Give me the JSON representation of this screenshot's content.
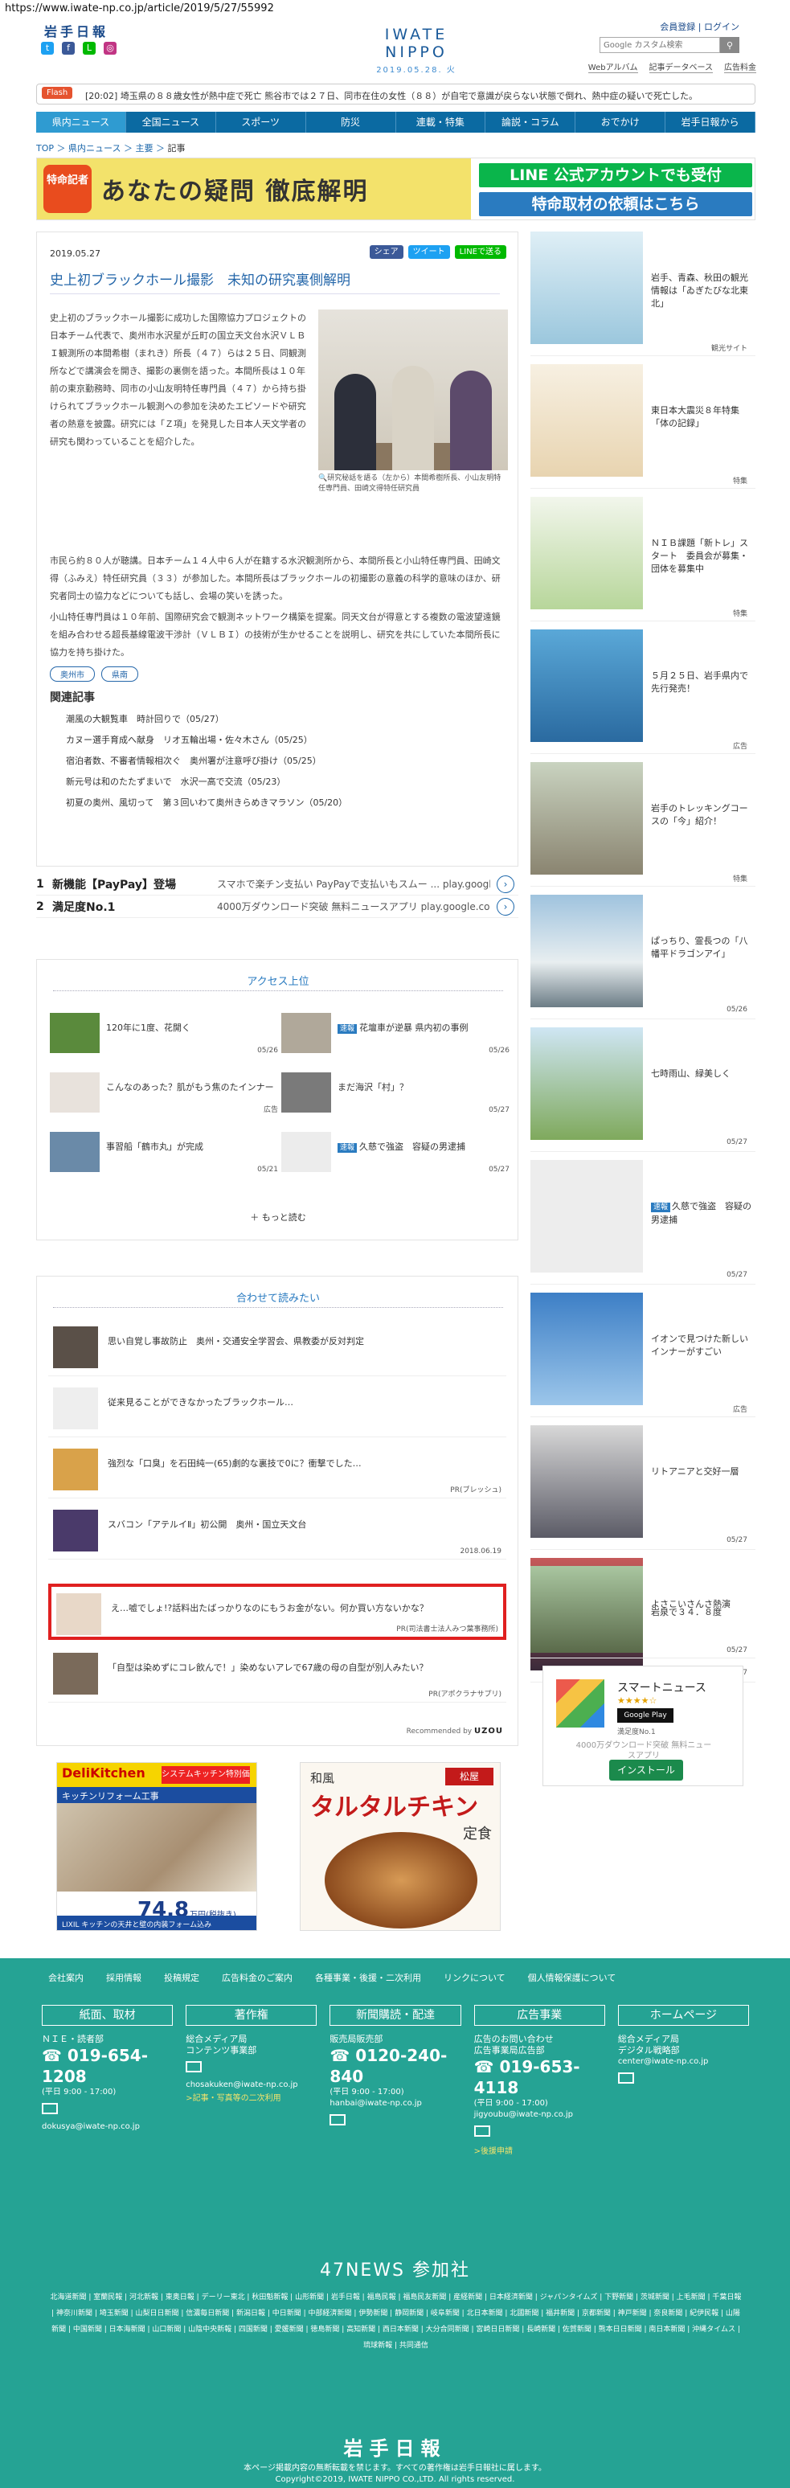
{
  "url": "https://www.iwate-np.co.jp/article/2019/5/27/55992",
  "header": {
    "logo_small": "岩手日報",
    "brand": "IWATE NIPPO",
    "brand_date": "2019.05.28. 火",
    "member_register": "会員登録",
    "login": "ログイン",
    "search_placeholder": "Google カスタム検索",
    "subnav": [
      "Webアルバム",
      "記事データベース",
      "広告料金"
    ]
  },
  "flash": {
    "tag": "Flash",
    "text": "[20:02] 埼玉県の８８歳女性が熱中症で死亡   熊谷市では２７日、同市在住の女性（８８）が自宅で意識が戻らない状態で倒れ、熱中症の疑いで死亡した。"
  },
  "gnav": [
    "県内ニュース",
    "全国ニュース",
    "スポーツ",
    "防災",
    "連載・特集",
    "論説・コラム",
    "おでかけ",
    "岩手日報から"
  ],
  "breadcrumb": [
    "TOP",
    "県内ニュース",
    "主要",
    "記事"
  ],
  "banner": {
    "badge": "特命記者",
    "title": "あなたの疑問 徹底解明",
    "line1": "LINE 公式アカウントでも受付",
    "line2": "特命取材の依頼はこちら"
  },
  "article": {
    "date": "2019.05.27",
    "share": [
      "シェア",
      "ツイート",
      "LINEで送る"
    ],
    "title": "史上初ブラックホール撮影　未知の研究裏側解明",
    "body_p1": "史上初のブラックホール撮影に成功した国際協力プロジェクトの日本チーム代表で、奥州市水沢星が丘町の国立天文台水沢ＶＬＢＩ観測所の本間希樹（まれき）所長（４７）らは２５日、同観測所などで講演会を開き、撮影の裏側を語った。本間所長は１０年前の東京勤務時、同市の小山友明特任専門員（４７）から持ち掛けられてブラックホール観測への参加を決めたエピソードや研究者の熱意を披露。研究には「Ｚ項」を発見した日本人天文学者の研究も関わっていることを紹介した。",
    "body_p2": "市民ら約８０人が聴講。日本チーム１４人中６人が在籍する水沢観測所から、本間所長と小山特任専門員、田崎文得（ふみえ）特任研究員（３３）が参加した。本間所長はブラックホールの初撮影の意義の科学的意味のほか、研究者同士の協力などについても話し、会場の笑いを誘った。",
    "body_p3": "小山特任専門員は１０年前、国際研究会で観測ネットワーク構築を提案。同天文台が得意とする複数の電波望遠鏡を組み合わせる超長基線電波干渉計（ＶＬＢＩ）の技術が生かせることを説明し、研究を共にしていた本間所長に協力を持ち掛けた。",
    "caption": "研究秘話を語る（左から）本間希樹所長、小山友明特任専門員、田崎文得特任研究員",
    "tags": [
      "奥州市",
      "県南"
    ],
    "related_heading": "関連記事",
    "related": [
      "潮風の大観覧車　時計回りで（05/27）",
      "カヌー選手育成へ献身　リオ五輪出場・佐々木さん（05/25）",
      "宿泊者数、不審者情報相次ぐ　奥州署が注意呼び掛け（05/25）",
      "新元号は和のたたずまいで　水沢一高で交流（05/23）",
      "初夏の奥州、風切って　第３回いわて奥州きらめきマラソン（05/20）"
    ]
  },
  "ads_inline": [
    {
      "num": "1",
      "title": "新機能【PayPay】登場",
      "desc": "スマホで楽チン支払い PayPayで支払いもスムー ... play.google.com"
    },
    {
      "num": "2",
      "title": "満足度No.1",
      "desc": "4000万ダウンロード突破 無料ニュースアプリ play.google.com"
    }
  ],
  "ranking": {
    "heading": "アクセス上位",
    "items": [
      {
        "badge": "",
        "text": "120年に1度、花開く",
        "date": "05/26"
      },
      {
        "badge": "速報",
        "text": "花壇車が逆暴 県内初の事例",
        "date": "05/26"
      },
      {
        "badge": "",
        "text": "こんなのあった？肌がもう焦のたインナー",
        "date": "広告"
      },
      {
        "badge": "",
        "text": "まだ海沢「村」？",
        "date": "05/27"
      },
      {
        "badge": "",
        "text": "事習船「鶴市丸」が完成",
        "date": "05/21"
      },
      {
        "badge": "速報",
        "text": "久慈で強盗　容疑の男逮捕",
        "date": "05/27"
      }
    ],
    "more": "もっと読む"
  },
  "recommended": {
    "heading": "合わせて読みたい",
    "items": [
      {
        "text": "思い自覚し事故防止　奥州・交通安全学習会、県教委が反対判定",
        "date": ""
      },
      {
        "text": "従来見ることができなかったブラックホール…",
        "date": ""
      },
      {
        "text": "強烈な「口臭」を石田純一(65)劇的な裏技で0に？衝撃でした…",
        "date": "PR(ブレッシュ)"
      },
      {
        "text": "スバコン「アテルイⅡ」初公開　奥州・国立天文台",
        "date": "2018.06.19"
      },
      {
        "text": "え…嘘でしょ!?話料出たばっかりなのにもうお金がない。何か買い方ないかな？",
        "date": "PR(司法書士法人みつ葉事務所)"
      },
      {
        "text": "「自型は染めずにコレ飲んで！」染めないアレで67歳の母の自型が別人みたい？",
        "date": "PR(アポクラナサプリ)"
      }
    ],
    "recommended_by": "Recommended by",
    "uzou": "UZOU"
  },
  "bottom_ads": {
    "ad1": {
      "brand": "DeliKitchen",
      "sub": "システムキッチン特別価格",
      "bar": "キッチンリフォーム工事",
      "price": "74.8",
      "unit": "万円(税抜き)",
      "footer": "LIXIL キッチンの天井と壁の内装フォーム込み"
    },
    "ad2": {
      "t1": "和風",
      "t2": "タルタルチキン",
      "logo": "松屋",
      "sub": "定食"
    }
  },
  "sidebar": [
    {
      "badge": "",
      "text": "岩手、青森、秋田の観光情報は「ゐぎたびな北東北」",
      "foot": "観光サイト"
    },
    {
      "badge": "",
      "text": "東日本大震災８年特集「体の記録」",
      "foot": "特集"
    },
    {
      "badge": "",
      "text": "ＮＩＢ課題「新トレ」スタート　委員会が募集・団体を募集中",
      "foot": "特集"
    },
    {
      "badge": "",
      "text": "５月２５日、岩手県内で先行発売！",
      "foot": "広告"
    },
    {
      "badge": "",
      "text": "岩手のトレッキングコースの「今」紹介！",
      "foot": "特集"
    },
    {
      "badge": "",
      "text": "ぱっちり、霊長つの「八幡平ドラゴンアイ」",
      "foot": "05/26"
    },
    {
      "badge": "",
      "text": "七時雨山、緑美しく",
      "foot": "05/27"
    },
    {
      "badge": "速報",
      "text": "久慈で強盗　容疑の男逮捕",
      "foot": "05/27"
    },
    {
      "badge": "",
      "text": "イオンで見つけた新しいインナーがすごい",
      "foot": "広告"
    },
    {
      "badge": "",
      "text": "リトアニアと交好一層",
      "foot": "05/27"
    },
    {
      "badge": "",
      "text": "よさこいさんさ熱演",
      "foot": "05/27"
    },
    {
      "badge": "",
      "text": "岩泉で３４．８度",
      "foot": "05/27"
    }
  ],
  "smart_news": {
    "name": "スマートニュース",
    "stars": "★★★★☆",
    "store": "Google Play",
    "sub": "満足度No.1",
    "desc": "4000万ダウンロード突破 無料ニュースアプリ",
    "button": "インストール"
  },
  "footer": {
    "links": [
      "会社案内",
      "採用情報",
      "投稿規定",
      "広告料金のご案内",
      "各種事業・後援・二次利用",
      "リンクについて",
      "個人情報保護について"
    ],
    "cols": [
      {
        "head": "紙面、取材",
        "label": "ＮＩＥ・読者部",
        "phone": "019-654-1208",
        "hours": "(平日 9:00 - 17:00)",
        "mail": "dokusya@iwate-np.co.jp",
        "extra": ""
      },
      {
        "head": "著作権",
        "label": "総合メディア局\nコンテンツ事業部",
        "phone": "",
        "hours": "",
        "mail": "chosakuken@iwate-np.co.jp",
        "extra": ">記事・写真等の二次利用"
      },
      {
        "head": "新聞購読・配達",
        "label": "販売局販売部",
        "phone": "0120-240-840",
        "hours": "(平日 9:00 - 17:00)",
        "mail": "hanbai@iwate-np.co.jp",
        "extra": ""
      },
      {
        "head": "広告事業",
        "label": "広告のお問い合わせ\n広告事業局広告部",
        "phone": "019-653-4118",
        "hours": "(平日 9:00 - 17:00)",
        "mail": "jigyoubu@iwate-np.co.jp",
        "extra": ">後援申請"
      },
      {
        "head": "ホームページ",
        "label": "総合メディア局\nデジタル戦略部",
        "phone": "",
        "hours": "",
        "mail": "center@iwate-np.co.jp",
        "extra": ""
      }
    ],
    "news47": "47NEWS 参加社",
    "papers": "北海道新聞 | 室蘭民報 | 河北新報 | 東奥日報 | デーリー東北 | 秋田魁新報 | 山形新聞 | 岩手日報 | 福島民報 | 福島民友新聞 | 産経新聞 | 日本経済新聞 | ジャパンタイムズ | 下野新聞 | 茨城新聞 | 上毛新聞 | 千葉日報 | 神奈川新聞 | 埼玉新聞 | 山梨日日新聞 | 信濃毎日新聞 | 新潟日報 | 中日新聞 | 中部経済新聞 | 伊勢新聞 | 静岡新聞 | 岐阜新聞 | 北日本新聞 | 北國新聞 | 福井新聞 | 京都新聞 | 神戸新聞 | 奈良新聞 | 紀伊民報 | 山陽新聞 | 中国新聞 | 日本海新聞 | 山口新聞 | 山陰中央新報 | 四国新聞 | 愛媛新聞 | 徳島新聞 | 高知新聞 | 西日本新聞 | 大分合同新聞 | 宮崎日日新聞 | 長崎新聞 | 佐賀新聞 | 熊本日日新聞 | 南日本新聞 | 沖縄タイムス | 琉球新報 | 共同通信",
    "logo": "岩手日報",
    "copy1": "本ページ掲載内容の無断転載を禁じます。すべての著作権は岩手日報社に属します。",
    "copy2": "Copyright©2019, IWATE NIPPO CO.,LTD. All rights reserved."
  },
  "colors": {
    "primary": "#0b6aa2",
    "accent": "#2a7bc0",
    "footer": "#25a394",
    "flash": "#e5532f",
    "highlight": "#e02020"
  }
}
